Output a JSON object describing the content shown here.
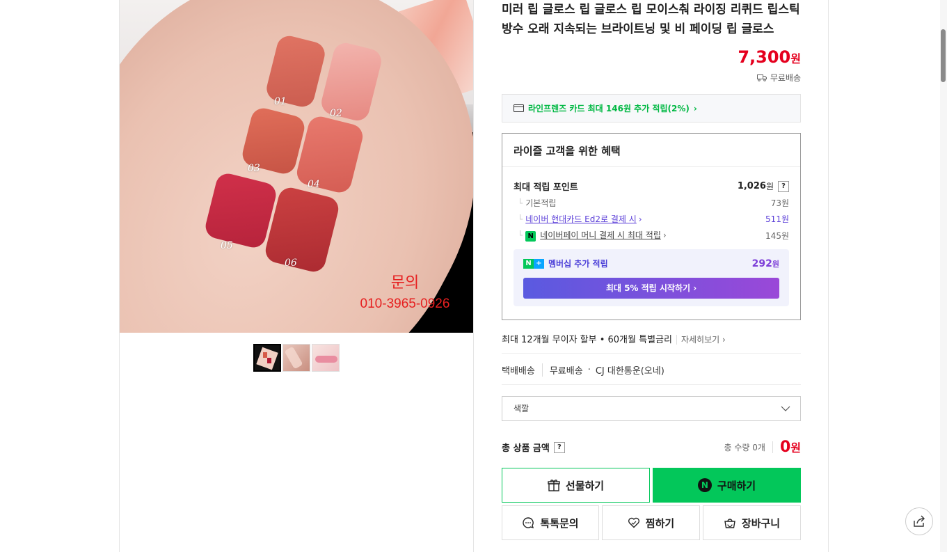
{
  "product": {
    "title_line1": "미러 립 글로스 립 글로스 립 모이스춰 라이징 리퀴드 립스틱",
    "title_line2": "방수 오래 지속되는 브라이트닝 및 비 페이딩 립 글로스",
    "price": "7,300",
    "price_unit": "원",
    "shipping_badge": "무료배송"
  },
  "image": {
    "swatch_labels": [
      "01",
      "02",
      "03",
      "04",
      "05",
      "06"
    ],
    "contact_title": "문의",
    "contact_phone": "010-3965-0926",
    "thumbnail_count": 3
  },
  "card_banner": {
    "text": "라인프렌즈 카드 최대 146원 추가 적립(2%)",
    "color": "#00b843"
  },
  "benefit": {
    "title": "라이즐 고객을 위한 혜택",
    "max_points_label": "최대 적립 포인트",
    "max_points_value": "1,026",
    "max_points_unit": "원",
    "help": "?",
    "rows": [
      {
        "label": "기본적립",
        "value": "73원"
      },
      {
        "label": "네이버 현대카드 Ed2로 결제 시",
        "value": "511원"
      },
      {
        "label": "네이버페이 머니 결제 시 최대 적립",
        "value": "145원"
      }
    ],
    "membership_label": "멤버십 추가 적립",
    "membership_value": "292",
    "membership_unit": "원",
    "membership_button": "최대 5% 적립 시작하기"
  },
  "installment": {
    "text": "최대 12개월 무이자 할부 • 60개월 특별금리",
    "more": "자세히보기"
  },
  "delivery": {
    "label": "택배배송",
    "fee": "무료배송",
    "carrier": "CJ 대한통운(오네)"
  },
  "option": {
    "placeholder": "색깔"
  },
  "total": {
    "label": "총 상품 금액",
    "help": "?",
    "quantity": "총 수량 0개",
    "amount": "0",
    "unit": "원"
  },
  "buttons": {
    "gift": "선물하기",
    "buy": "구매하기",
    "talk": "톡톡문의",
    "wish": "찜하기",
    "cart": "장바구니"
  },
  "colors": {
    "brand_green": "#03c75a",
    "price_red": "#e5001e",
    "membership_purple": "#7d3fd8"
  }
}
